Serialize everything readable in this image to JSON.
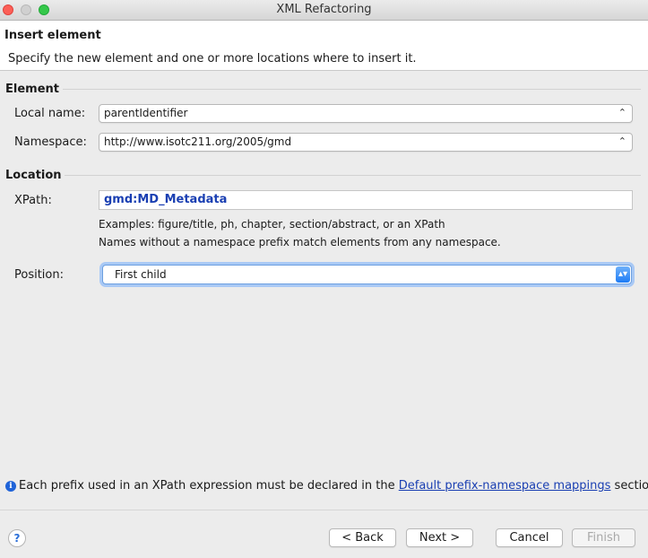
{
  "window": {
    "title": "XML Refactoring"
  },
  "header": {
    "title": "Insert element",
    "description": "Specify the new element and one or more locations where to insert it."
  },
  "element_section": {
    "label": "Element",
    "local_name_label": "Local name:",
    "local_name_value": "parentIdentifier",
    "namespace_label": "Namespace:",
    "namespace_value": "http://www.isotc211.org/2005/gmd"
  },
  "location_section": {
    "label": "Location",
    "xpath_label": "XPath:",
    "xpath_value": "gmd:MD_Metadata",
    "hint_line1": "Examples: figure/title, ph, chapter, section/abstract, or an XPath",
    "hint_line2": "Names without a namespace prefix match elements from any namespace.",
    "position_label": "Position:",
    "position_value": "First child"
  },
  "info": {
    "text_before": "Each prefix used in an XPath expression must be declared in the ",
    "link_text": "Default prefix-namespace mappings",
    "text_after": " section."
  },
  "footer": {
    "help_label": "?",
    "back_label": "< Back",
    "next_label": "Next >",
    "cancel_label": "Cancel",
    "finish_label": "Finish"
  },
  "icons": {
    "combo_chevron": "up-down-chevron-icon",
    "info": "info-icon",
    "help": "help-icon"
  },
  "colors": {
    "xpath_text": "#1a3fb2",
    "focus_ring": "#a9c9f5",
    "select_accent": "#1e7cf5"
  }
}
